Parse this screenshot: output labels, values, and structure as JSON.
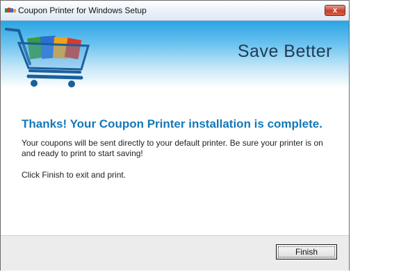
{
  "window": {
    "title": "Coupon Printer for Windows Setup",
    "close_glyph": "x"
  },
  "banner": {
    "tagline": "Save Better"
  },
  "main": {
    "headline": "Thanks! Your Coupon Printer installation is complete.",
    "body_line1": "Your coupons will be sent directly to your default printer. Be sure your printer is on and ready to print to start saving!",
    "body_line2": "Click Finish to exit and print."
  },
  "footer": {
    "finish_label": "Finish"
  },
  "colors": {
    "headline": "#1478b8",
    "banner_top": "#2aa4e4",
    "close_button": "#c6402a"
  },
  "icons": [
    "app-icon",
    "shopping-cart-icon",
    "close-icon"
  ]
}
